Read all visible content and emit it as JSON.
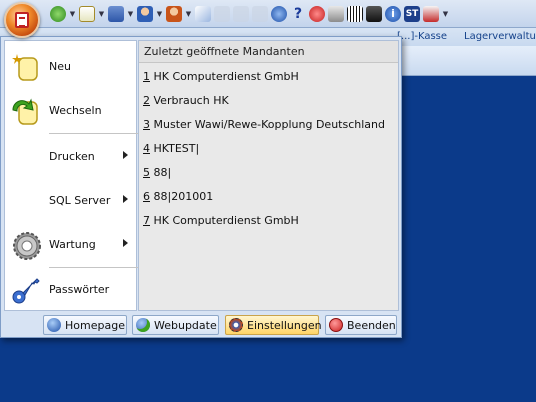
{
  "ribbon": {
    "tabs": [
      "[...]-Kasse",
      "Lagerverwaltu[...]"
    ]
  },
  "menu": {
    "left_items": [
      {
        "label": "Neu",
        "icon": "new-document-icon",
        "has_submenu": false
      },
      {
        "label": "Wechseln",
        "icon": "switch-arrow-icon",
        "has_submenu": false
      },
      {
        "label": "Drucken",
        "icon": "",
        "has_submenu": true
      },
      {
        "label": "SQL Server",
        "icon": "",
        "has_submenu": true
      },
      {
        "label": "Wartung",
        "icon": "gear-icon",
        "has_submenu": true
      },
      {
        "label": "Passwörter",
        "icon": "key-icon",
        "has_submenu": false
      }
    ],
    "recent": {
      "title": "Zuletzt geöffnete Mandanten",
      "items": [
        {
          "num": "1",
          "label": "HK Computerdienst GmbH"
        },
        {
          "num": "2",
          "label": "Verbrauch HK"
        },
        {
          "num": "3",
          "label": "Muster Wawi/Rewe-Kopplung Deutschland"
        },
        {
          "num": "4",
          "label": "HKTEST|"
        },
        {
          "num": "5",
          "label": "88|"
        },
        {
          "num": "6",
          "label": "88|201001"
        },
        {
          "num": "7",
          "label": "HK Computerdienst GmbH"
        }
      ]
    },
    "bottom_buttons": [
      {
        "label": "Homepage",
        "icon": "globe-icon"
      },
      {
        "label": "Webupdate",
        "icon": "globe-update-icon"
      },
      {
        "label": "Einstellungen",
        "icon": "settings-icon"
      },
      {
        "label": "Beenden",
        "icon": "exit-icon"
      }
    ]
  },
  "colors": {
    "desktop": "#0b3a8a",
    "accent_orange": "#f08a2a",
    "exit_red": "#cc2222"
  }
}
